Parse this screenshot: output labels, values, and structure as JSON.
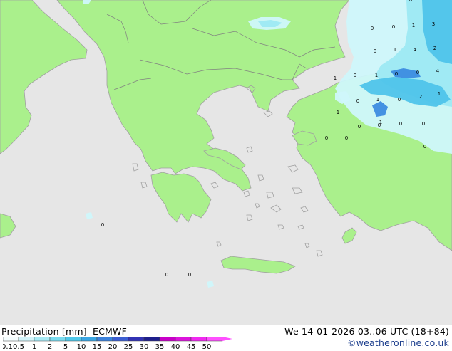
{
  "colors": {
    "sea": "#e6e6e6",
    "land": "#aaf08c",
    "coast": "#a0a0a0",
    "border": "#808080",
    "precip_light": "#cff7fb",
    "precip_mid": "#9de9f3",
    "precip_strong": "#4fc4ea",
    "precip_heavy": "#3c8ce0"
  },
  "footer": {
    "title": "Precipitation [mm]",
    "model": "ECMWF",
    "valid": "We 14-01-2026 03..06 UTC (18+84)",
    "credit": "©weatheronline.co.uk"
  },
  "legend": {
    "labels": [
      "0.1",
      "0.5",
      "1",
      "2",
      "5",
      "10",
      "15",
      "20",
      "25",
      "30",
      "35",
      "40",
      "45",
      "50"
    ],
    "colors": [
      "#f5fdfe",
      "#d2f4fa",
      "#a8eaf5",
      "#7adcf0",
      "#4fc8ea",
      "#3aa6e4",
      "#3c82dc",
      "#3c5ed2",
      "#3232b4",
      "#1e1e8c",
      "#c800c8",
      "#dc14dc",
      "#f028f0",
      "#ff50ff"
    ]
  },
  "map_values": [
    {
      "t": "0"
    },
    {
      "t": "0"
    },
    {
      "t": "1"
    },
    {
      "t": "3"
    },
    {
      "t": "0"
    },
    {
      "t": "1"
    },
    {
      "t": "4"
    },
    {
      "t": "2"
    },
    {
      "t": "1"
    },
    {
      "t": "0"
    },
    {
      "t": "1"
    },
    {
      "t": "0"
    },
    {
      "t": "0"
    },
    {
      "t": "4"
    },
    {
      "t": "0"
    },
    {
      "t": "1"
    },
    {
      "t": "0"
    },
    {
      "t": "2"
    },
    {
      "t": "1"
    },
    {
      "t": "0"
    },
    {
      "t": "0"
    },
    {
      "t": "0"
    },
    {
      "t": "0"
    },
    {
      "t": "0"
    },
    {
      "t": "0"
    },
    {
      "t": "0"
    },
    {
      "t": "0"
    },
    {
      "t": "0"
    },
    {
      "t": "0"
    },
    {
      "t": "0"
    },
    {
      "t": "1"
    },
    {
      "t": "1"
    }
  ]
}
